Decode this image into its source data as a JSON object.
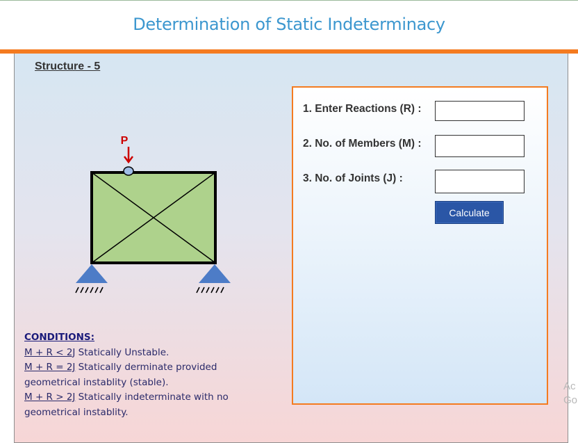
{
  "header": {
    "title": "Determination of Static Indeterminacy"
  },
  "structure": {
    "label": "Structure - 5",
    "load_label": "P"
  },
  "form": {
    "reactions_label": "1. Enter Reactions (R) :",
    "members_label": "2. No. of Members (M) :",
    "joints_label": "3. No. of Joints (J) :",
    "reactions_value": "",
    "members_value": "",
    "joints_value": "",
    "calculate_label": "Calculate"
  },
  "conditions": {
    "heading": "CONDITIONS:",
    "c1_eq": "M + R < 2J",
    "c1_text": " Statically Unstable.",
    "c2_eq": "M + R = 2J",
    "c2_text": " Statically derminate provided geometrical instablity (stable).",
    "c3_eq": "M + R > 2J",
    "c3_text": " Statically indeterminate with no geometrical instablity."
  },
  "watermark": {
    "line1": "Ac",
    "line2": "Go"
  },
  "colors": {
    "accent": "#f47b20",
    "title": "#3c97cf",
    "button": "#2a56a6",
    "frame_fill": "#aed28c",
    "support": "#4472c4"
  }
}
